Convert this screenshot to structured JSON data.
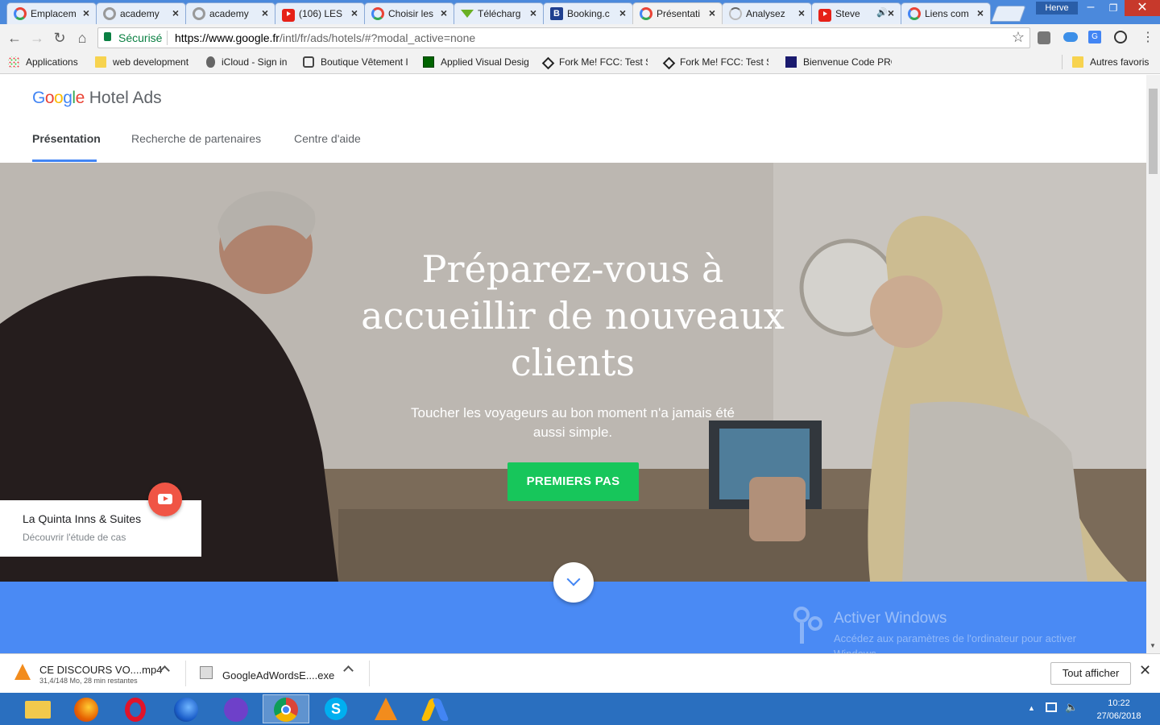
{
  "window": {
    "user_label": "Herve",
    "tabs": [
      {
        "label": "Emplacem",
        "icon": "google-icon"
      },
      {
        "label": "academy",
        "icon": "google-icon"
      },
      {
        "label": "academy",
        "icon": "google-icon"
      },
      {
        "label": "(106) LES",
        "icon": "youtube-icon"
      },
      {
        "label": "Choisir les",
        "icon": "google-icon"
      },
      {
        "label": "Télécharg",
        "icon": "download-icon"
      },
      {
        "label": "Booking.c",
        "icon": "booking-icon"
      },
      {
        "label": "Présentati",
        "icon": "google-icon"
      },
      {
        "label": "Analysez",
        "icon": "loading-icon"
      },
      {
        "label": "Steve",
        "icon": "youtube-icon"
      },
      {
        "label": "Liens com",
        "icon": "google-icon"
      }
    ]
  },
  "toolbar": {
    "secure_label": "Sécurisé",
    "url_host": "https://www.google.fr",
    "url_path": "/intl/fr/ads/hotels/#?modal_active=none"
  },
  "bookmarks": {
    "items": [
      {
        "label": "Applications",
        "icon": "apps-grid-icon"
      },
      {
        "label": "web development",
        "icon": "folder-icon"
      },
      {
        "label": "iCloud - Sign in",
        "icon": "apple-icon"
      },
      {
        "label": "Boutique Vêtement I",
        "icon": "shop-icon"
      },
      {
        "label": "Applied Visual Desig",
        "icon": "fcc-icon"
      },
      {
        "label": "Fork Me! FCC: Test S",
        "icon": "codepen-icon"
      },
      {
        "label": "Fork Me! FCC: Test S",
        "icon": "codepen-icon"
      },
      {
        "label": "Bienvenue Code PRO",
        "icon": "codepro-icon"
      }
    ],
    "other_label": "Autres favoris"
  },
  "site": {
    "logo_google": "Google",
    "logo_product": "Hotel Ads",
    "nav": [
      {
        "label": "Présentation",
        "active": true
      },
      {
        "label": "Recherche de partenaires",
        "active": false
      },
      {
        "label": "Centre d'aide",
        "active": false
      }
    ],
    "hero": {
      "title_line1": "Préparez-vous à",
      "title_line2": "accueillir de nouveaux",
      "title_line3": "clients",
      "subtitle_line1": "Toucher les voyageurs au bon moment n'a jamais été",
      "subtitle_line2": "aussi simple.",
      "cta": "PREMIERS PAS"
    },
    "case_study": {
      "title": "La Quinta Inns & Suites",
      "link": "Découvrir l'étude de cas"
    },
    "watermark": {
      "title": "Activer Windows",
      "text_line1": "Accédez aux paramètres de l'ordinateur pour activer",
      "text_line2": "Windows."
    }
  },
  "downloads": {
    "items": [
      {
        "name": "CE DISCOURS VO....mp4",
        "status": "31,4/148 Mo, 28 min restantes"
      },
      {
        "name": "GoogleAdWordsE....exe",
        "status": ""
      }
    ],
    "show_all": "Tout afficher"
  },
  "taskbar": {
    "time": "10:22",
    "date": "27/06/2018"
  },
  "colors": {
    "accent_green": "#1ed760",
    "cta_green": "#17c65b",
    "blue_band": "#4a8af4",
    "taskbar": "#2a6fbf"
  }
}
